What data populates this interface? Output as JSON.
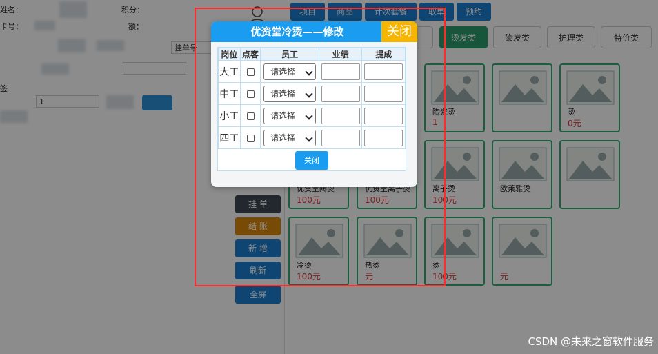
{
  "background": {
    "left_labels": {
      "name": "姓名：",
      "card": "卡号：",
      "points": "积分：",
      "balance": "额：",
      "sign": "签"
    },
    "left_fields": {
      "order_placeholder": "挂单号",
      "qty": "1"
    },
    "top_tabs": [
      "项目",
      "商品",
      "计次套餐",
      "取单",
      "预约"
    ],
    "categories": [
      {
        "label": "烫发类",
        "active": true
      },
      {
        "label": "染发类",
        "active": false
      },
      {
        "label": "护理类",
        "active": false
      },
      {
        "label": "特价类",
        "active": false
      }
    ],
    "side_buttons": [
      {
        "label": "挂 单",
        "color": "#3f4a55"
      },
      {
        "label": "结 账",
        "color": "#d9880a"
      },
      {
        "label": "新 增",
        "color": "#1c7fd0"
      },
      {
        "label": "刷新",
        "color": "#1c7fd0"
      },
      {
        "label": "全屏",
        "color": "#1c7fd0"
      }
    ],
    "cards": [
      {
        "name": "",
        "price": ""
      },
      {
        "name": "",
        "price": ""
      },
      {
        "name": "陶瓷烫",
        "price": "1"
      },
      {
        "name": "",
        "price": ""
      },
      {
        "name": "烫",
        "price": "0元"
      },
      {
        "name": "优资堂陶烫",
        "price": "100元"
      },
      {
        "name": "优资堂离子烫",
        "price": "100元"
      },
      {
        "name": "离子烫",
        "price": "100元"
      },
      {
        "name": "欧莱雅烫",
        "price": ""
      },
      {
        "name": "",
        "price": ""
      },
      {
        "name": "冷烫",
        "price": "100元"
      },
      {
        "name": "热烫",
        "price": "元"
      },
      {
        "name": "烫",
        "price": "100元"
      },
      {
        "name": "",
        "price": "元"
      }
    ]
  },
  "modal": {
    "title": "优资堂冷烫——修改",
    "close_top_label": "关闭",
    "columns": [
      "岗位",
      "点客",
      "员工",
      "业绩",
      "提成"
    ],
    "rows": [
      {
        "position": "大工",
        "employee": "请选择"
      },
      {
        "position": "中工",
        "employee": "请选择"
      },
      {
        "position": "小工",
        "employee": "请选择"
      },
      {
        "position": "四工",
        "employee": "请选择"
      }
    ],
    "close_button_label": "关闭"
  },
  "watermark": "CSDN @未来之窗软件服务",
  "colors": {
    "header_blue": "#1a9df0",
    "close_orange": "#f5b500",
    "highlight_red": "#ff2a2a",
    "active_green": "#2a9d6b"
  }
}
